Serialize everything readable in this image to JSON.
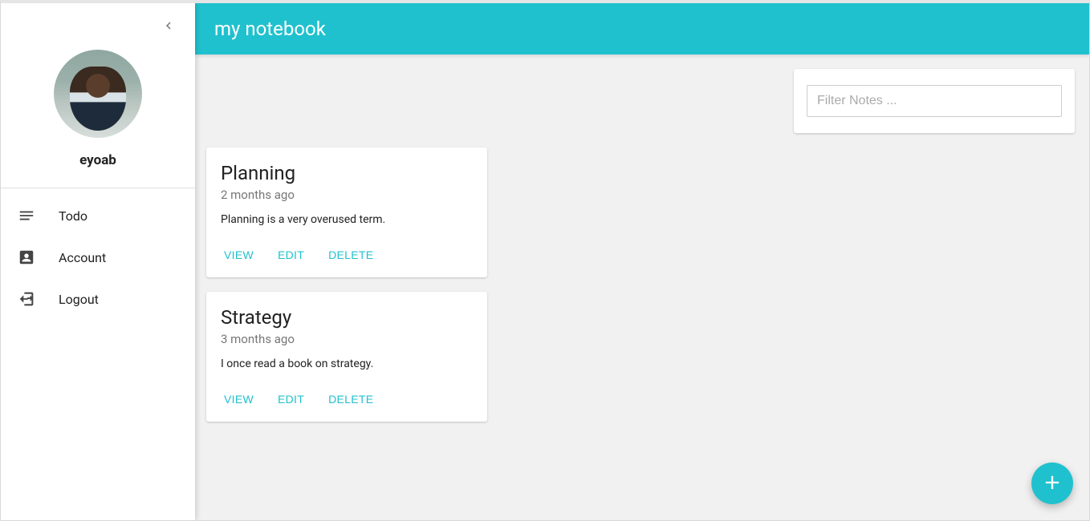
{
  "app": {
    "title": "my notebook"
  },
  "user": {
    "name": "eyoab"
  },
  "sidebar": {
    "items": [
      {
        "label": "Todo",
        "icon": "notes-icon"
      },
      {
        "label": "Account",
        "icon": "account-icon"
      },
      {
        "label": "Logout",
        "icon": "logout-icon"
      }
    ]
  },
  "filter": {
    "placeholder": "Filter Notes ..."
  },
  "actions": {
    "view": "VIEW",
    "edit": "EDIT",
    "delete": "DELETE"
  },
  "notes": [
    {
      "title": "Planning",
      "time": "2 months ago",
      "body": "Planning is a very overused term."
    },
    {
      "title": "Strategy",
      "time": "3 months ago",
      "body": "I once read a book on strategy."
    }
  ]
}
